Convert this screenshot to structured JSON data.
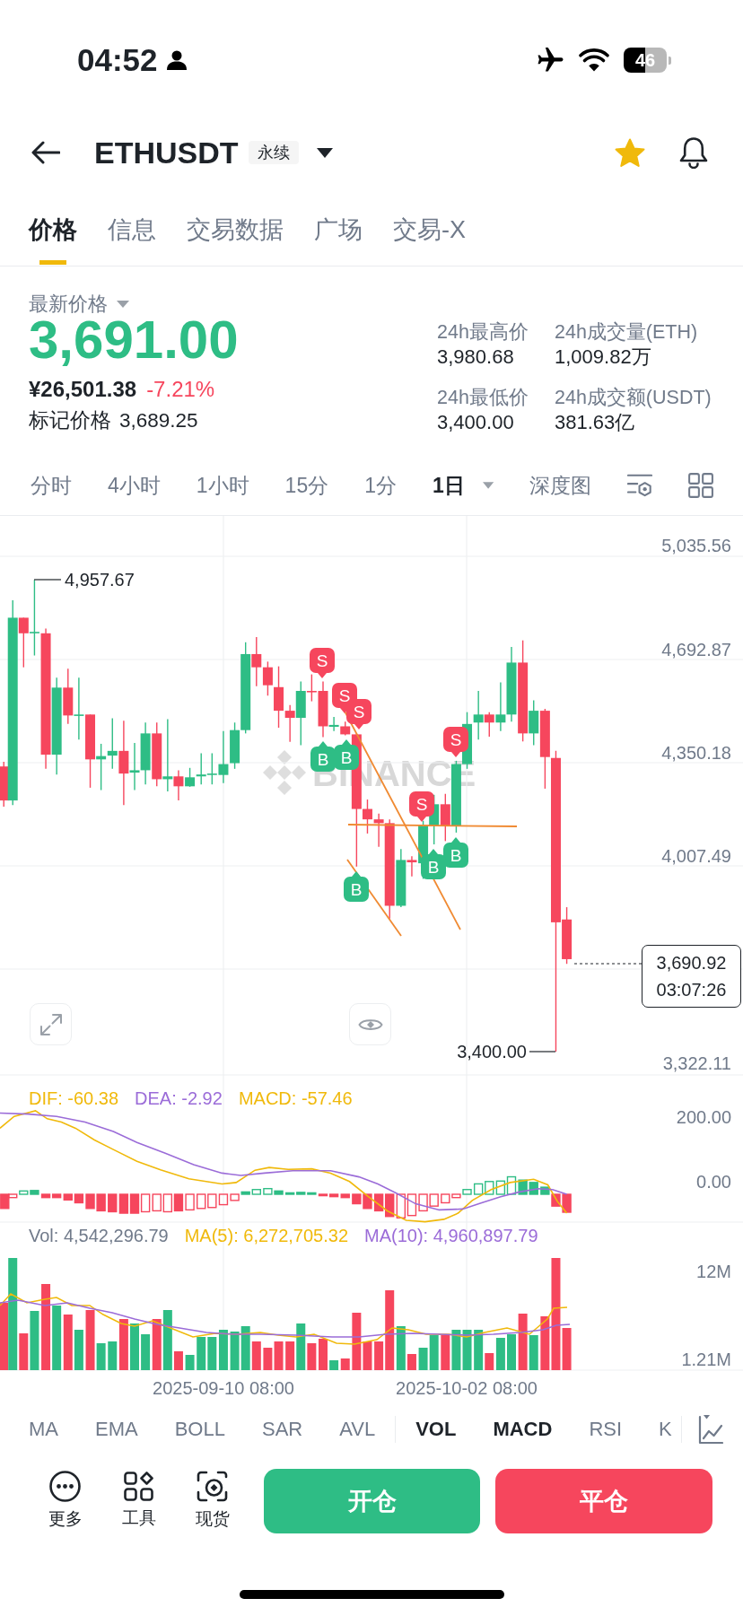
{
  "status_bar": {
    "time": "04:52",
    "battery": "46"
  },
  "header": {
    "symbol": "ETHUSDT",
    "badge": "永续",
    "favorite": true
  },
  "tabs": [
    {
      "label": "价格",
      "selected": true
    },
    {
      "label": "信息",
      "selected": false
    },
    {
      "label": "交易数据",
      "selected": false
    },
    {
      "label": "广场",
      "selected": false
    },
    {
      "label": "交易-X",
      "selected": false
    }
  ],
  "price": {
    "label": "最新价格",
    "last": "3,691.00",
    "last_up": true,
    "cny": "¥26,501.38",
    "change": "-7.21%",
    "change_up": false,
    "mark_label": "标记价格",
    "mark_value": "3,689.25"
  },
  "stats": [
    {
      "label": "24h最高价",
      "value": "3,980.68"
    },
    {
      "label": "24h成交量(ETH)",
      "value": "1,009.82万"
    },
    {
      "label": "24h最低价",
      "value": "3,400.00"
    },
    {
      "label": "24h成交额(USDT)",
      "value": "381.63亿"
    }
  ],
  "intervals": [
    {
      "label": "分时",
      "selected": false,
      "dropdown": false
    },
    {
      "label": "4小时",
      "selected": false,
      "dropdown": false
    },
    {
      "label": "1小时",
      "selected": false,
      "dropdown": false
    },
    {
      "label": "15分",
      "selected": false,
      "dropdown": false
    },
    {
      "label": "1分",
      "selected": false,
      "dropdown": false
    },
    {
      "label": "1日",
      "selected": true,
      "dropdown": true
    },
    {
      "label": "深度图",
      "selected": false,
      "dropdown": false
    }
  ],
  "chart": {
    "watermark": "BINANCE",
    "y_ticks": [
      "5,035.56",
      "4,692.87",
      "4,350.18",
      "4,007.49",
      "3,322.11"
    ],
    "high_label": "4,957.67",
    "low_label": "3,400.00",
    "current_price": "3,690.92",
    "countdown": "03:07:26",
    "markers": [
      {
        "kind": "sell",
        "label": "S"
      },
      {
        "kind": "sell",
        "label": "S"
      },
      {
        "kind": "sell",
        "label": "S"
      },
      {
        "kind": "sell",
        "label": "S"
      },
      {
        "kind": "buy",
        "label": "B"
      },
      {
        "kind": "buy",
        "label": "B"
      },
      {
        "kind": "sell",
        "label": "S"
      },
      {
        "kind": "buy",
        "label": "B"
      },
      {
        "kind": "buy",
        "label": "B"
      },
      {
        "kind": "buy",
        "label": "B"
      }
    ]
  },
  "macd": {
    "legend": [
      {
        "label": "DIF: -60.38",
        "color": "#f0b90b"
      },
      {
        "label": "DEA: -2.92",
        "color": "#9b6cd8"
      },
      {
        "label": "MACD: -57.46",
        "color": "#f0b90b"
      }
    ],
    "y_ticks": [
      "200.00",
      "0.00"
    ]
  },
  "volume": {
    "legend": [
      {
        "label": "Vol: 4,542,296.79",
        "color": "#707a8a"
      },
      {
        "label": "MA(5): 6,272,705.32",
        "color": "#f0b90b"
      },
      {
        "label": "MA(10): 4,960,897.79",
        "color": "#9b6cd8"
      }
    ],
    "y_ticks": [
      "12M",
      "1.21M"
    ]
  },
  "x_labels": [
    "2025-09-10 08:00",
    "2025-10-02 08:00"
  ],
  "indicators": {
    "main": [
      {
        "label": "MA",
        "selected": false
      },
      {
        "label": "EMA",
        "selected": false
      },
      {
        "label": "BOLL",
        "selected": false
      },
      {
        "label": "SAR",
        "selected": false
      },
      {
        "label": "AVL",
        "selected": false
      }
    ],
    "sub": [
      {
        "label": "VOL",
        "selected": true
      },
      {
        "label": "MACD",
        "selected": true
      },
      {
        "label": "RSI",
        "selected": false
      },
      {
        "label": "K",
        "selected": false
      }
    ]
  },
  "bottom_bar": {
    "tools": [
      {
        "kind": "more",
        "label": "更多"
      },
      {
        "kind": "tools",
        "label": "工具"
      },
      {
        "kind": "spot",
        "label": "现货"
      }
    ],
    "buttons": [
      {
        "kind": "open",
        "label": "开仓"
      },
      {
        "kind": "close",
        "label": "平仓"
      }
    ]
  }
}
